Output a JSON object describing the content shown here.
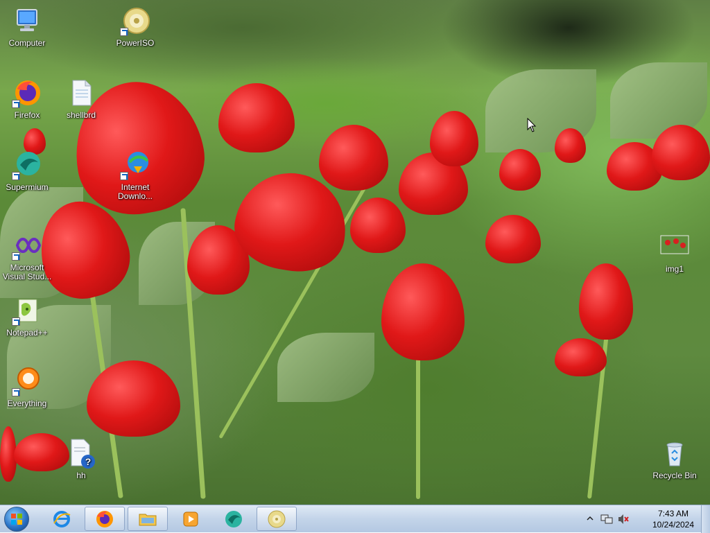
{
  "desktop": {
    "icons": [
      {
        "label": "Computer",
        "icon": "computer-icon"
      },
      {
        "label": "PowerISO",
        "icon": "poweriso-icon"
      },
      {
        "label": "Firefox",
        "icon": "firefox-icon"
      },
      {
        "label": "shellbrd",
        "icon": "text-file-icon"
      },
      {
        "label": "Supermium",
        "icon": "supermium-icon"
      },
      {
        "label": "Internet Downlo...",
        "icon": "idm-icon"
      },
      {
        "label": "Microsoft Visual Stud...",
        "icon": "visual-studio-icon"
      },
      {
        "label": "Notepad++",
        "icon": "notepadpp-icon"
      },
      {
        "label": "Everything",
        "icon": "everything-icon"
      },
      {
        "label": "hh",
        "icon": "help-file-icon"
      },
      {
        "label": "img1",
        "icon": "image-file-icon"
      },
      {
        "label": "Recycle Bin",
        "icon": "recycle-bin-icon"
      }
    ]
  },
  "taskbar": {
    "start_label": "Start",
    "pinned": [
      {
        "name": "Internet Explorer",
        "icon": "ie-icon"
      },
      {
        "name": "Firefox",
        "icon": "firefox-icon"
      },
      {
        "name": "Windows Explorer",
        "icon": "folder-icon"
      },
      {
        "name": "Media Player",
        "icon": "media-player-icon"
      },
      {
        "name": "Supermium",
        "icon": "supermium-icon"
      },
      {
        "name": "PowerISO",
        "icon": "poweriso-icon"
      }
    ],
    "tray": {
      "time": "7:43 AM",
      "date": "10/24/2024"
    }
  },
  "colors": {
    "taskbar": "#c3d4e9",
    "tulip_red": "#e01818",
    "foliage_green": "#5b8a38"
  }
}
